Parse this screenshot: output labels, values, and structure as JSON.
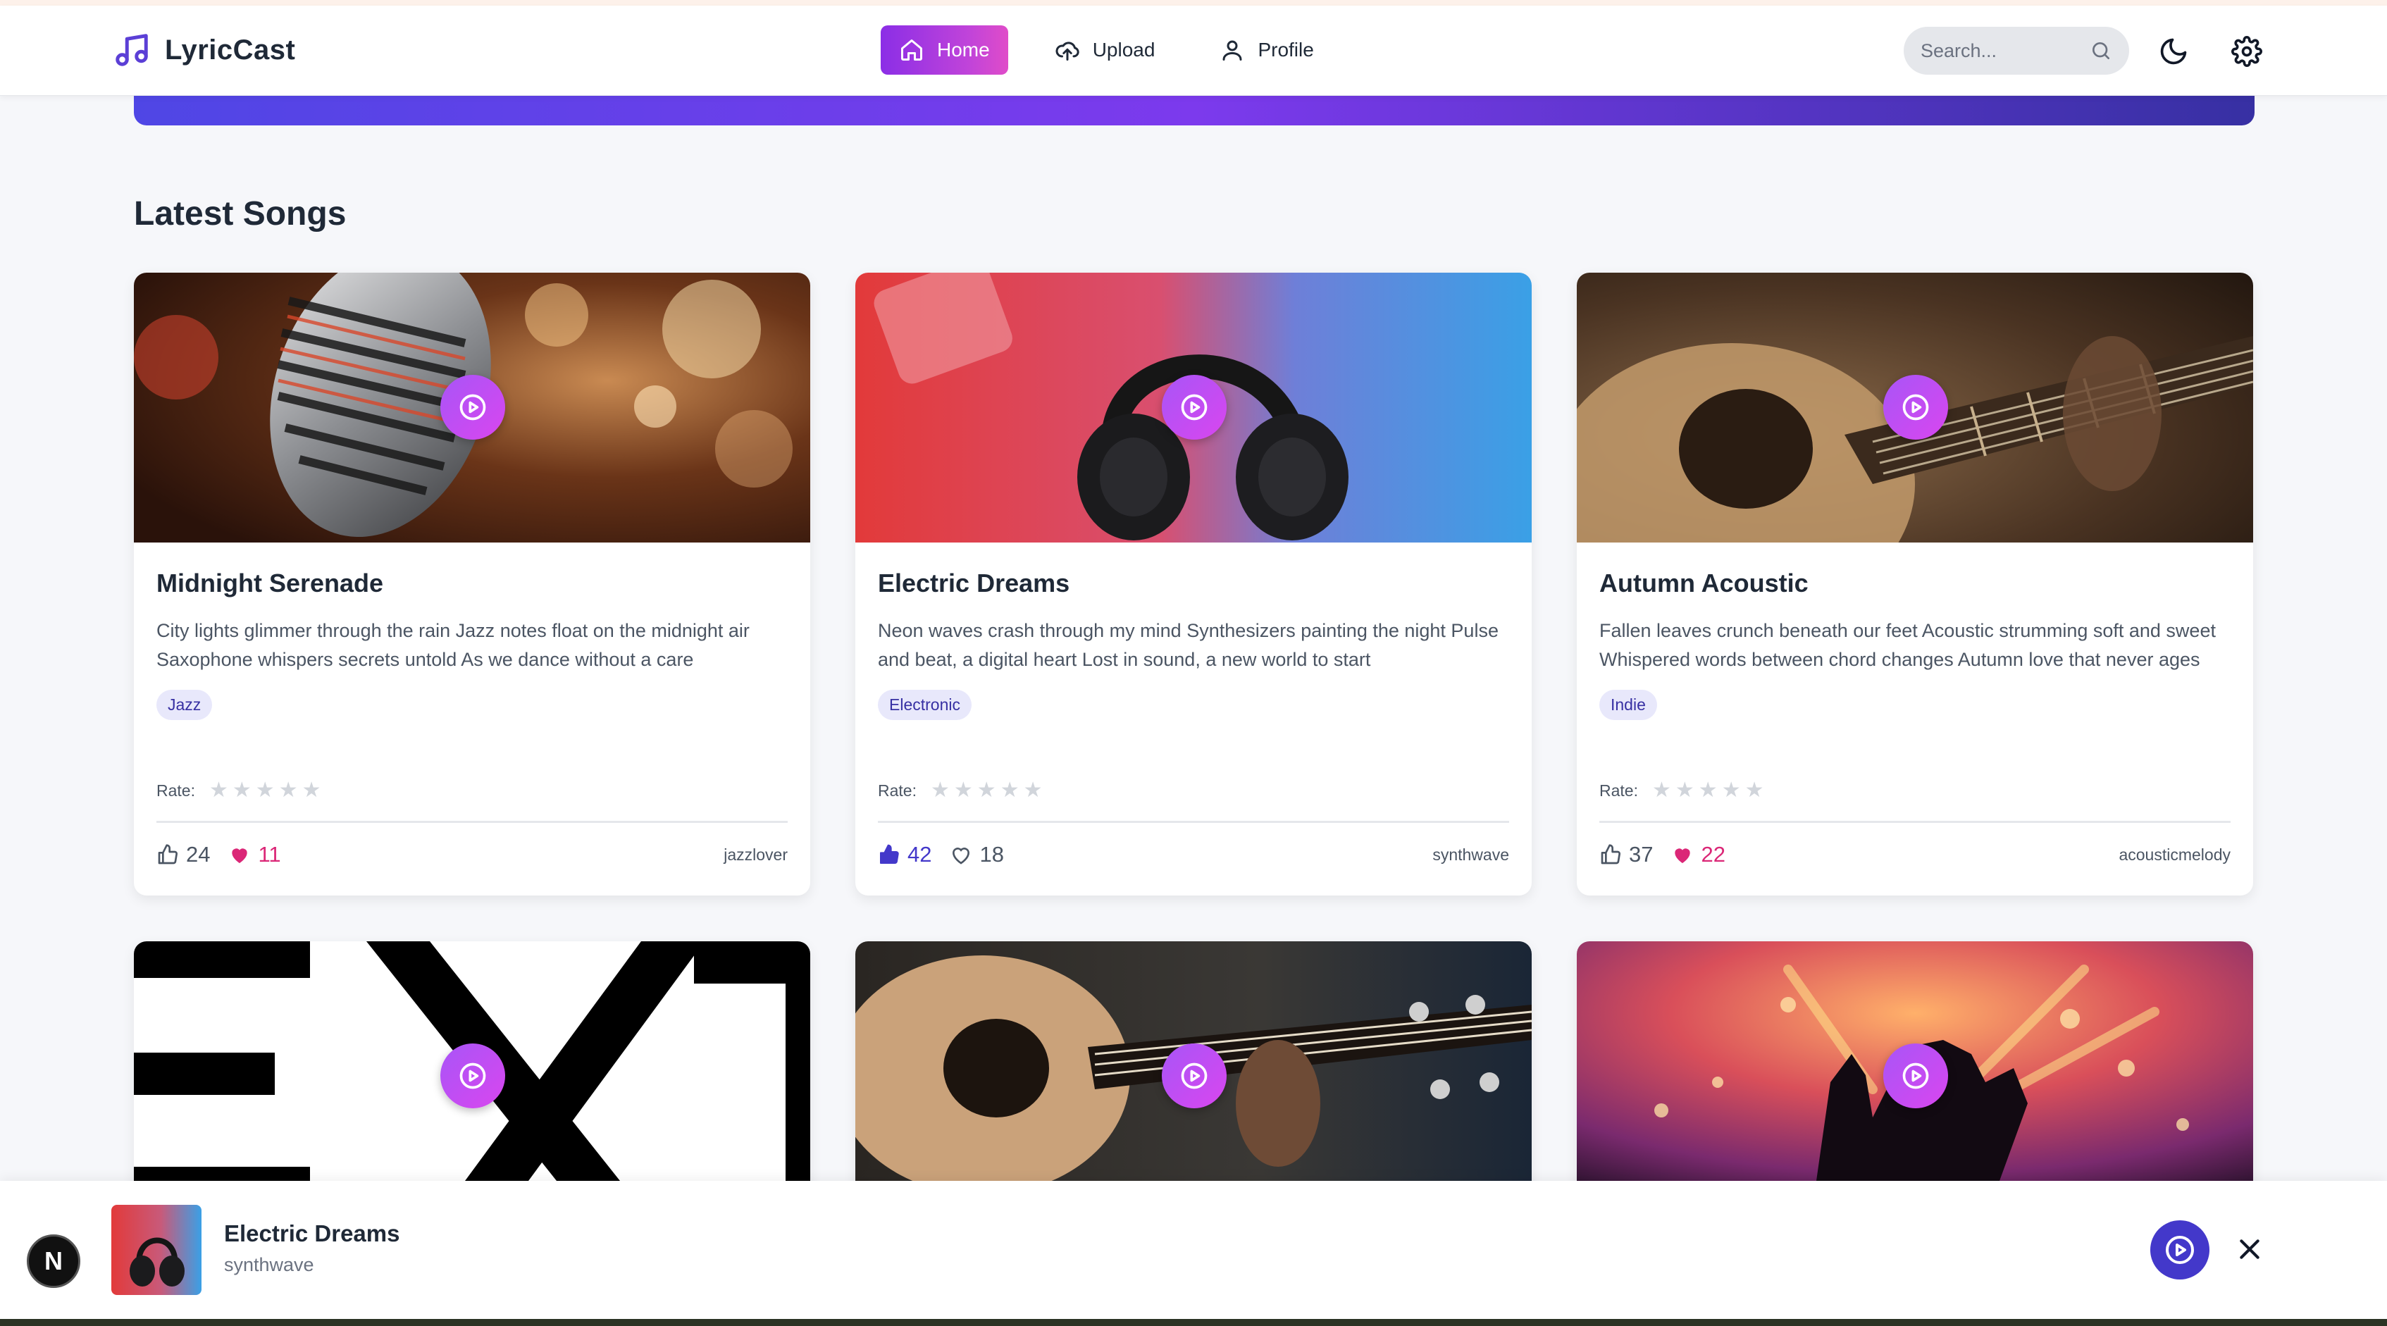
{
  "nav": {
    "brand": "LyricCast",
    "links": [
      {
        "label": "Home",
        "icon": "home-icon",
        "active": true
      },
      {
        "label": "Upload",
        "icon": "upload-cloud-icon",
        "active": false
      },
      {
        "label": "Profile",
        "icon": "user-icon",
        "active": false
      }
    ],
    "search_placeholder": "Search...",
    "accent_gradient": [
      "#8b2ee6",
      "#e04cc9"
    ]
  },
  "section": {
    "title": "Latest Songs"
  },
  "rate_label": "Rate:",
  "songs": [
    {
      "title": "Midnight Serenade",
      "lyrics": "City lights glimmer through the rain Jazz notes float on the midnight air Saxophone whispers secrets untold As we dance without a care",
      "genre": "Jazz",
      "likes": "24",
      "loves": "11",
      "liked": false,
      "loved": true,
      "author": "jazzlover",
      "image": "vintage-microphone"
    },
    {
      "title": "Electric Dreams",
      "lyrics": "Neon waves crash through my mind Synthesizers painting the night Pulse and beat, a digital heart Lost in sound, a new world to start",
      "genre": "Electronic",
      "likes": "42",
      "loves": "18",
      "liked": true,
      "loved": false,
      "author": "synthwave",
      "image": "headphones-neon"
    },
    {
      "title": "Autumn Acoustic",
      "lyrics": "Fallen leaves crunch beneath our feet Acoustic strumming soft and sweet Whispered words between chord changes Autumn love that never ages",
      "genre": "Indie",
      "likes": "37",
      "loves": "22",
      "liked": false,
      "loved": true,
      "author": "acousticmelody",
      "image": "acoustic-guitar-closeup"
    }
  ],
  "row2_images": [
    "ex-logo-graphic",
    "guitar-player",
    "concert-crowd"
  ],
  "player": {
    "title": "Electric Dreams",
    "artist": "synthwave",
    "badge": "N"
  }
}
